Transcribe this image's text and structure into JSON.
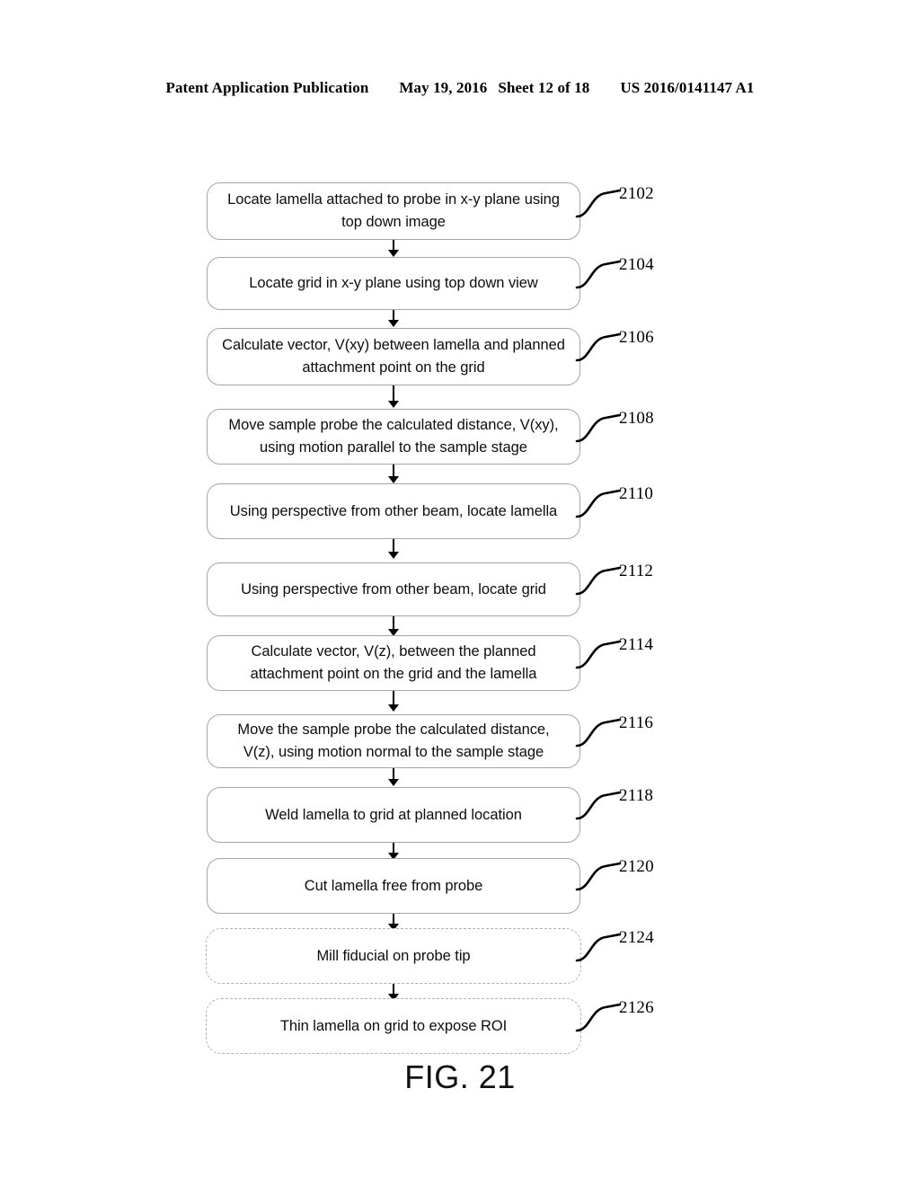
{
  "header": {
    "publication": "Patent Application Publication",
    "date": "May 19, 2016",
    "sheet": "Sheet 12 of 18",
    "doc_number": "US 2016/0141147 A1"
  },
  "figure": {
    "caption": "FIG. 21"
  },
  "colors": {
    "box_border": "#a6a6a6",
    "dashed_border": "#b0b0b0",
    "text": "#0d0d0d",
    "arrow": "#000000",
    "page_background": "#ffffff"
  },
  "flowchart": {
    "title": "FIG. 21",
    "orientation": "vertical",
    "nodes": [
      {
        "ref": "2102",
        "text": "Locate lamella attached to probe in x-y plane using top down image",
        "style": "solid",
        "lines": 2
      },
      {
        "ref": "2104",
        "text": "Locate grid in x-y plane using top down view",
        "style": "solid",
        "lines": 1
      },
      {
        "ref": "2106",
        "text": "Calculate vector, V(xy) between lamella and planned attachment point on the grid",
        "style": "solid",
        "lines": 2
      },
      {
        "ref": "2108",
        "text": "Move sample probe the calculated distance, V(xy), using motion parallel to the sample stage",
        "style": "solid",
        "lines": 2
      },
      {
        "ref": "2110",
        "text": "Using perspective from other beam, locate lamella",
        "style": "solid",
        "lines": 2
      },
      {
        "ref": "2112",
        "text": "Using perspective from other beam, locate grid",
        "style": "solid",
        "lines": 1
      },
      {
        "ref": "2114",
        "text": "Calculate vector, V(z), between the planned attachment point on the grid and the lamella",
        "style": "solid",
        "lines": 2
      },
      {
        "ref": "2116",
        "text": "Move the sample probe the calculated distance, V(z), using motion normal to the sample stage",
        "style": "solid",
        "lines": 2
      },
      {
        "ref": "2118",
        "text": "Weld lamella to grid at planned location",
        "style": "solid",
        "lines": 1
      },
      {
        "ref": "2120",
        "text": "Cut lamella free from probe",
        "style": "solid",
        "lines": 1
      },
      {
        "ref": "2124",
        "text": "Mill fiducial on probe tip",
        "style": "dashed",
        "lines": 1
      },
      {
        "ref": "2126",
        "text": "Thin lamella on grid to expose ROI",
        "style": "dashed",
        "lines": 1
      }
    ],
    "connections": [
      {
        "from": "2102",
        "to": "2104",
        "type": "arrow"
      },
      {
        "from": "2104",
        "to": "2106",
        "type": "arrow"
      },
      {
        "from": "2106",
        "to": "2108",
        "type": "arrow"
      },
      {
        "from": "2108",
        "to": "2110",
        "type": "arrow"
      },
      {
        "from": "2110",
        "to": "2112",
        "type": "arrow"
      },
      {
        "from": "2112",
        "to": "2114",
        "type": "arrow"
      },
      {
        "from": "2114",
        "to": "2116",
        "type": "arrow"
      },
      {
        "from": "2116",
        "to": "2118",
        "type": "arrow"
      },
      {
        "from": "2118",
        "to": "2120",
        "type": "arrow"
      },
      {
        "from": "2120",
        "to": "2124",
        "type": "arrow"
      },
      {
        "from": "2124",
        "to": "2126",
        "type": "arrow"
      }
    ]
  }
}
